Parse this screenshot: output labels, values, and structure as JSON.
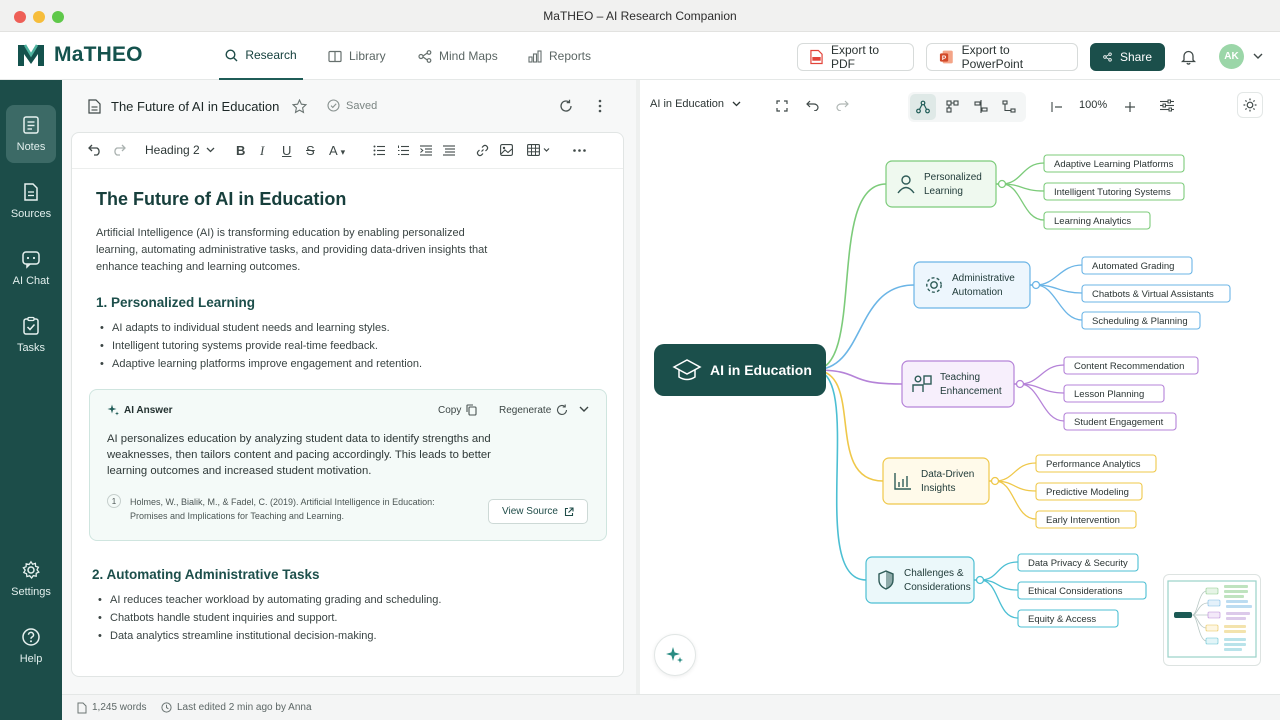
{
  "window": {
    "title": "MaTHEO – AI Research Companion"
  },
  "app": {
    "name": "MaTHEO"
  },
  "nav": {
    "tabs": [
      {
        "label": "Research",
        "icon": "search-icon",
        "active": true
      },
      {
        "label": "Library",
        "icon": "book-icon",
        "active": false
      },
      {
        "label": "Mind Maps",
        "icon": "mindmap-icon",
        "active": false
      },
      {
        "label": "Reports",
        "icon": "bar-chart-icon",
        "active": false
      }
    ]
  },
  "header": {
    "export_pdf": "Export to PDF",
    "export_ppt": "Export to PowerPoint",
    "share": "Share",
    "avatar_initials": "AK"
  },
  "sidebar": {
    "items": [
      {
        "label": "Notes",
        "icon": "notes-icon",
        "active": true
      },
      {
        "label": "Sources",
        "icon": "document-icon",
        "active": false
      },
      {
        "label": "AI Chat",
        "icon": "chat-icon",
        "active": false
      },
      {
        "label": "Tasks",
        "icon": "tasks-icon",
        "active": false
      },
      {
        "label": "Settings",
        "icon": "gear-icon",
        "active": false
      },
      {
        "label": "Help",
        "icon": "help-icon",
        "active": false
      }
    ]
  },
  "document": {
    "title": "The Future of AI in Education",
    "saved_label": "Saved",
    "heading_style": "Heading 2",
    "h1": "The Future of AI in Education",
    "intro": "Artificial Intelligence (AI) is transforming education by enabling personalized learning, automating administrative tasks, and providing data-driven insights that enhance teaching and learning outcomes.",
    "sections": [
      {
        "heading": "1. Personalized Learning",
        "bullets": [
          "AI adapts to individual student needs and learning styles.",
          "Intelligent tutoring systems provide real-time feedback.",
          "Adaptive learning platforms improve engagement and retention."
        ]
      },
      {
        "heading": "2. Automating Administrative Tasks",
        "bullets": [
          "AI reduces teacher workload by automating grading and scheduling.",
          "Chatbots handle student inquiries and support.",
          "Data analytics streamline institutional decision-making."
        ]
      }
    ],
    "ai_answer": {
      "label": "AI Answer",
      "copy": "Copy",
      "regenerate": "Regenerate",
      "body": "AI personalizes education by analyzing student data to identify strengths and weaknesses, then tailors content and pacing accordingly. This leads to better learning outcomes and increased student motivation.",
      "citation_number": "1",
      "citation": "Holmes, W., Bialik, M., & Fadel, C. (2019). Artificial Intelligence in Education: Promises and Implications for Teaching and Learning.",
      "view_source": "View Source"
    }
  },
  "status": {
    "words": "1,245 words",
    "last_edited": "Last edited 2 min ago by Anna"
  },
  "mindmap": {
    "selector": "AI in Education",
    "zoom": "100%",
    "root": "AI in Education",
    "branches": [
      {
        "label": [
          "Personalized",
          "Learning"
        ],
        "color": "#7ccb7a",
        "icon": "user-icon",
        "children": [
          "Adaptive Learning Platforms",
          "Intelligent Tutoring Systems",
          "Learning Analytics"
        ]
      },
      {
        "label": [
          "Administrative",
          "Automation"
        ],
        "color": "#6bb5e6",
        "icon": "gear-icon",
        "children": [
          "Automated Grading",
          "Chatbots & Virtual Assistants",
          "Scheduling & Planning"
        ]
      },
      {
        "label": [
          "Teaching",
          "Enhancement"
        ],
        "color": "#b583d8",
        "icon": "teacher-icon",
        "children": [
          "Content Recommendation",
          "Lesson Planning",
          "Student Engagement"
        ]
      },
      {
        "label": [
          "Data-Driven",
          "Insights"
        ],
        "color": "#efc84a",
        "icon": "chart-icon",
        "children": [
          "Performance Analytics",
          "Predictive Modeling",
          "Early Intervention"
        ]
      },
      {
        "label": [
          "Challenges &",
          "Considerations"
        ],
        "color": "#4cbfd3",
        "icon": "shield-icon",
        "children": [
          "Data Privacy & Security",
          "Ethical Considerations",
          "Equity & Access"
        ]
      }
    ]
  }
}
